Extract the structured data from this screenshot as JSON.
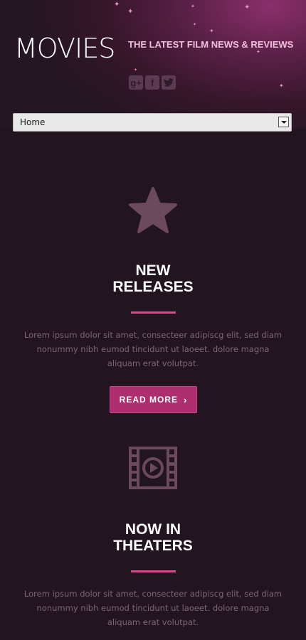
{
  "header": {
    "logo": "MOVIES",
    "tagline": "THE LATEST FILM NEWS & REVIEWS",
    "social": [
      {
        "icon": "google-plus-icon",
        "glyph": "g+"
      },
      {
        "icon": "facebook-icon",
        "glyph": "f"
      },
      {
        "icon": "twitter-icon",
        "glyph": "t"
      }
    ]
  },
  "nav": {
    "selected": "Home"
  },
  "sections": [
    {
      "icon": "star-icon",
      "title_line1": "NEW",
      "title_line2": "RELEASES",
      "text": "Lorem ipsum dolor sit amet, consecteer adipiscg elit, sed diam nonummy nibh eumod tincidunt ut laoeet. dolore magna aliquam erat volutpat.",
      "button": "READ MORE",
      "button_arrow": "›"
    },
    {
      "icon": "film-play-icon",
      "title_line1": "NOW IN",
      "title_line2": "THEATERS",
      "text": "Lorem ipsum dolor sit amet, consecteer adipiscg elit, sed diam nonummy nibh eumod tincidunt ut laoeet. dolore magna aliquam erat volutpat."
    }
  ],
  "colors": {
    "background": "#221520",
    "accent": "#ad2f6f",
    "divider": "#d24b8f",
    "icon": "#6b4a5e",
    "text_muted": "#7e6573"
  }
}
